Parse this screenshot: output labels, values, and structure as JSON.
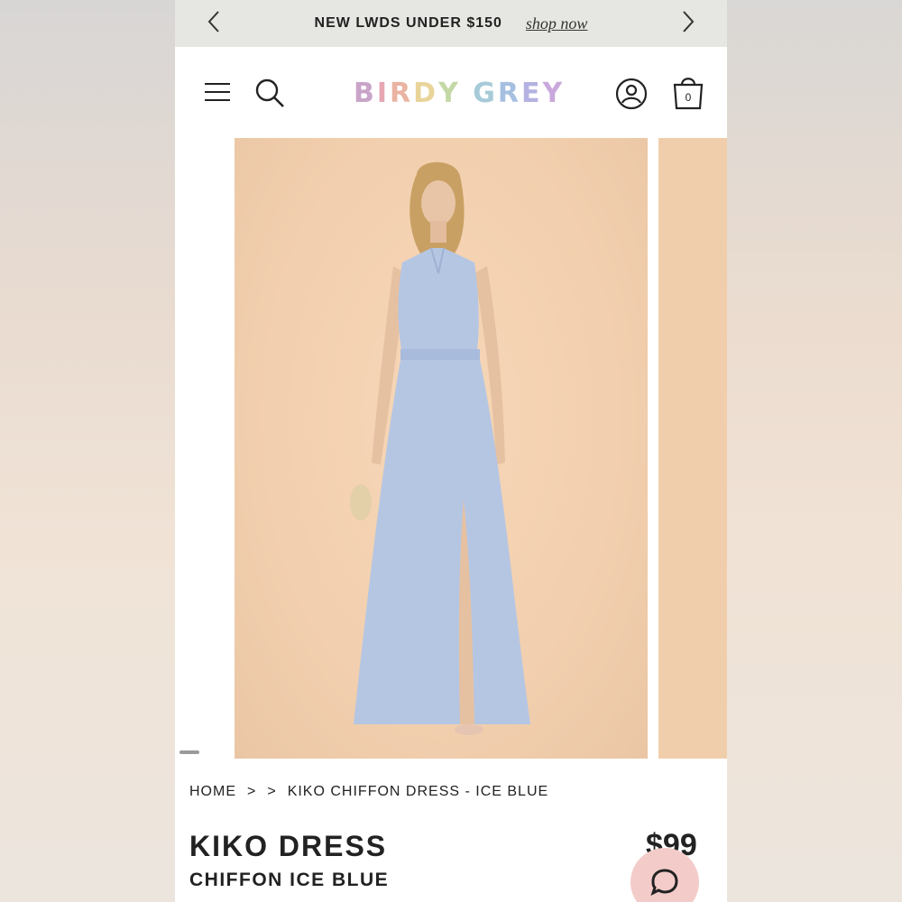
{
  "promo": {
    "text": "NEW LWDS UNDER $150",
    "link": "shop now"
  },
  "header": {
    "logo_letters": [
      {
        "ch": "B",
        "color": "#c9a4c8"
      },
      {
        "ch": "I",
        "color": "#e6a6b2"
      },
      {
        "ch": "R",
        "color": "#eab3a2"
      },
      {
        "ch": "D",
        "color": "#e9d49a"
      },
      {
        "ch": "Y",
        "color": "#c4d8a6"
      },
      {
        "ch": " ",
        "color": "#ffffff"
      },
      {
        "ch": "G",
        "color": "#a7cbd8"
      },
      {
        "ch": "R",
        "color": "#a5bfe0"
      },
      {
        "ch": "E",
        "color": "#b4b2e0"
      },
      {
        "ch": "Y",
        "color": "#c9a9dc"
      }
    ],
    "cart_count": "0",
    "icons": [
      "menu-icon",
      "search-icon",
      "account-icon",
      "cart-icon"
    ]
  },
  "breadcrumb": {
    "home": "HOME",
    "sep1": ">",
    "sep2": ">",
    "current": "KIKO CHIFFON DRESS - ICE BLUE"
  },
  "product": {
    "title": "KIKO DRESS",
    "subtitle": "CHIFFON ICE BLUE",
    "price": "$99"
  },
  "colors": {
    "promo_bg": "#e6e7e2",
    "image_bg": "#f2cfae",
    "dress": "#b5c6e3",
    "chat_bg": "#f3ccc9"
  }
}
